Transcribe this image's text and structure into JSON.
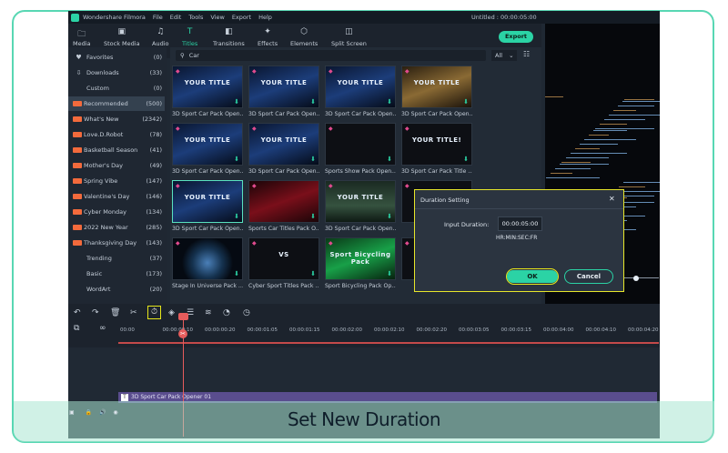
{
  "app": {
    "name": "Wondershare Filmora",
    "menu": [
      "File",
      "Edit",
      "Tools",
      "View",
      "Export",
      "Help"
    ],
    "project_title": "Untitled : 00:00:05:00"
  },
  "toolbar": {
    "tabs": [
      {
        "label": "Media",
        "icon": "folder-icon"
      },
      {
        "label": "Stock Media",
        "icon": "stock-media-icon"
      },
      {
        "label": "Audio",
        "icon": "music-icon"
      },
      {
        "label": "Titles",
        "icon": "text-icon"
      },
      {
        "label": "Transitions",
        "icon": "transitions-icon"
      },
      {
        "label": "Effects",
        "icon": "effects-icon"
      },
      {
        "label": "Elements",
        "icon": "elements-icon"
      },
      {
        "label": "Split Screen",
        "icon": "split-screen-icon"
      }
    ],
    "active_tab": "Titles",
    "export_label": "Export"
  },
  "sidebar": {
    "items": [
      {
        "label": "Favorites",
        "count": "(0)",
        "icon": "heart-icon",
        "hot": false
      },
      {
        "label": "Downloads",
        "count": "(33)",
        "icon": "download-icon",
        "hot": false
      },
      {
        "label": "Custom",
        "count": "(0)",
        "icon": "",
        "hot": false
      },
      {
        "label": "Recommended",
        "count": "(500)",
        "icon": "",
        "hot": true
      },
      {
        "label": "What's New",
        "count": "(2342)",
        "icon": "",
        "hot": true
      },
      {
        "label": "Love.D.Robot",
        "count": "(78)",
        "icon": "",
        "hot": true
      },
      {
        "label": "Basketball Season",
        "count": "(41)",
        "icon": "",
        "hot": true
      },
      {
        "label": "Mother's Day",
        "count": "(49)",
        "icon": "",
        "hot": true
      },
      {
        "label": "Spring Vibe",
        "count": "(147)",
        "icon": "",
        "hot": true
      },
      {
        "label": "Valentine's Day",
        "count": "(146)",
        "icon": "",
        "hot": true
      },
      {
        "label": "Cyber Monday",
        "count": "(134)",
        "icon": "",
        "hot": true
      },
      {
        "label": "2022 New Year",
        "count": "(285)",
        "icon": "",
        "hot": true
      },
      {
        "label": "Thanksgiving Day",
        "count": "(143)",
        "icon": "",
        "hot": true
      },
      {
        "label": "Trending",
        "count": "(37)",
        "icon": "",
        "hot": false
      },
      {
        "label": "Basic",
        "count": "(173)",
        "icon": "",
        "hot": false
      },
      {
        "label": "WordArt",
        "count": "(20)",
        "icon": "",
        "hot": false
      }
    ]
  },
  "search": {
    "value": "Car",
    "filter": "All"
  },
  "grid": {
    "items": [
      {
        "caption": "3D Sport Car Pack Open...",
        "overlay": "YOUR TITLE",
        "style": "space"
      },
      {
        "caption": "3D Sport Car Pack Open...",
        "overlay": "YOUR TITLE",
        "style": "space"
      },
      {
        "caption": "3D Sport Car Pack Open...",
        "overlay": "YOUR TITLE",
        "style": "space"
      },
      {
        "caption": "3D Sport Car Pack Open...",
        "overlay": "YOUR TITLE",
        "style": "gold"
      },
      {
        "caption": "3D Sport Car Pack Open...",
        "overlay": "YOUR TITLE",
        "style": "space"
      },
      {
        "caption": "3D Sport Car Pack Open...",
        "overlay": "YOUR TITLE",
        "style": "space"
      },
      {
        "caption": "Sports Show Pack Open...",
        "overlay": "",
        "style": "dark"
      },
      {
        "caption": "3D Sport Car Pack Title ...",
        "overlay": "YOUR TITLE!",
        "style": "dark"
      },
      {
        "caption": "3D Sport Car Pack Open...",
        "overlay": "YOUR TITLE",
        "style": "space"
      },
      {
        "caption": "Sports Car Titles Pack O...",
        "overlay": "",
        "style": "red"
      },
      {
        "caption": "3D Sport Car Pack Open...",
        "overlay": "YOUR TITLE",
        "style": "forest"
      },
      {
        "caption": "",
        "overlay": "",
        "style": "dark"
      },
      {
        "caption": "Stage In Universe Pack ...",
        "overlay": "",
        "style": "earth"
      },
      {
        "caption": "Cyber Sport Titles Pack ...",
        "overlay": "VS",
        "style": "dark"
      },
      {
        "caption": "Sport Bicycling Pack Op...",
        "overlay": "Sport Bicycling Pack",
        "style": "bike"
      },
      {
        "caption": "",
        "overlay": "",
        "style": "dark"
      }
    ]
  },
  "timeline": {
    "ticks": [
      "00:00",
      "00:00:00:10",
      "00:00:00:20",
      "00:00:01:05",
      "00:00:01:15",
      "00:00:02:00",
      "00:00:02:10",
      "00:00:02:20",
      "00:00:03:05",
      "00:00:03:15",
      "00:00:04:00",
      "00:00:04:10",
      "00:00:04:20"
    ],
    "clip_label": "3D Sport Car Pack Opener 01"
  },
  "dialog": {
    "title": "Duration Setting",
    "input_label": "Input Duration:",
    "input_value": "00:00:05:00",
    "format_hint": "HR:MIN:SEC:FR",
    "ok_label": "OK",
    "cancel_label": "Cancel"
  },
  "banner": {
    "text": "Set New Duration"
  },
  "colors": {
    "accent": "#2bd3a5",
    "highlight": "#e6e61a",
    "playhead": "#e65c5c",
    "clip": "#5a4d8e"
  }
}
